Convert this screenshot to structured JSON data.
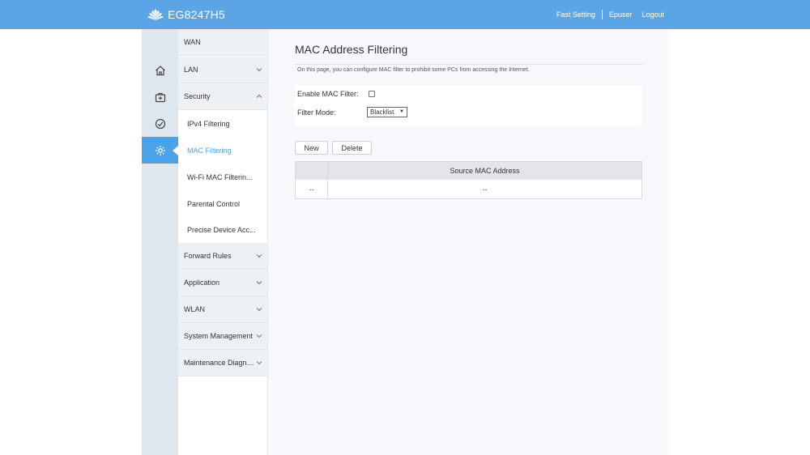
{
  "header": {
    "model": "EG8247H5",
    "links": {
      "fast_setting": "Fast Setting",
      "user": "Epuser",
      "logout": "Logout"
    }
  },
  "rail": {
    "items": [
      {
        "icon": "home-icon"
      },
      {
        "icon": "briefcase-plus-icon"
      },
      {
        "icon": "gauge-icon"
      },
      {
        "icon": "gear-icon",
        "active": true
      }
    ]
  },
  "menu": {
    "items": [
      {
        "label": "WAN",
        "type": "group"
      },
      {
        "label": "LAN",
        "type": "group",
        "chevron": "down"
      },
      {
        "label": "Security",
        "type": "group",
        "chevron": "up"
      },
      {
        "label": "IPv4 Filtering",
        "type": "sub"
      },
      {
        "label": "MAC Filtering",
        "type": "sub",
        "active": true
      },
      {
        "label": "Wi-Fi MAC Filterin...",
        "type": "sub"
      },
      {
        "label": "Parental Control",
        "type": "sub"
      },
      {
        "label": "Precise Device Acc...",
        "type": "sub"
      },
      {
        "label": "Forward Rules",
        "type": "group",
        "chevron": "down"
      },
      {
        "label": "Application",
        "type": "group",
        "chevron": "down"
      },
      {
        "label": "WLAN",
        "type": "group",
        "chevron": "down"
      },
      {
        "label": "System Management",
        "type": "group",
        "chevron": "down"
      },
      {
        "label": "Maintenance Diagno...",
        "type": "group",
        "chevron": "down"
      }
    ]
  },
  "main": {
    "title": "MAC Address Filtering",
    "description": "On this page, you can configure MAC filter to prohibit some PCs from accessing the Internet.",
    "form": {
      "enable_label": "Enable MAC Filter:",
      "mode_label": "Filter Mode:",
      "mode_value": "Blacklist"
    },
    "buttons": {
      "new": "New",
      "delete": "Delete"
    },
    "table": {
      "header": [
        "",
        "Source MAC Address"
      ],
      "rows": [
        [
          "--",
          "--"
        ]
      ]
    }
  },
  "colors": {
    "accent": "#5ba4e6",
    "active": "#4aa3e8",
    "rail": "#dfe7ee"
  }
}
